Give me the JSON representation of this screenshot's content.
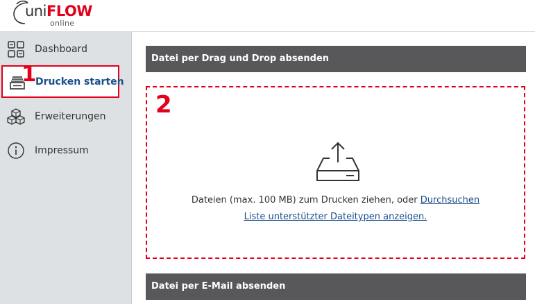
{
  "header": {
    "logo": {
      "brand_a": "uni",
      "brand_b": "FLOW",
      "sub": "online"
    }
  },
  "sidebar": {
    "items": [
      {
        "label": "Dashboard",
        "icon": "dashboard-grid-icon"
      },
      {
        "label": "Drucken starten",
        "icon": "printer-tray-icon",
        "active": true
      },
      {
        "label": "Erweiterungen",
        "icon": "cubes-icon"
      },
      {
        "label": "Impressum",
        "icon": "info-circle-icon"
      }
    ],
    "marker": "1"
  },
  "main": {
    "drag_drop_title": "Datei per Drag und Drop absenden",
    "dropzone": {
      "marker": "2",
      "icon": "upload-tray-icon",
      "text_prefix": "Dateien (max. 100 MB) zum Drucken ziehen, oder",
      "browse_link": "Durchsuchen",
      "filetypes_link": "Liste unterstützter Dateitypen anzeigen."
    },
    "email_title": "Datei per E-Mail absenden"
  },
  "colors": {
    "accent_red": "#e2001a",
    "link_blue": "#1a4f8b",
    "sidebar_bg": "#dde1e3",
    "section_bar": "#58585a"
  }
}
